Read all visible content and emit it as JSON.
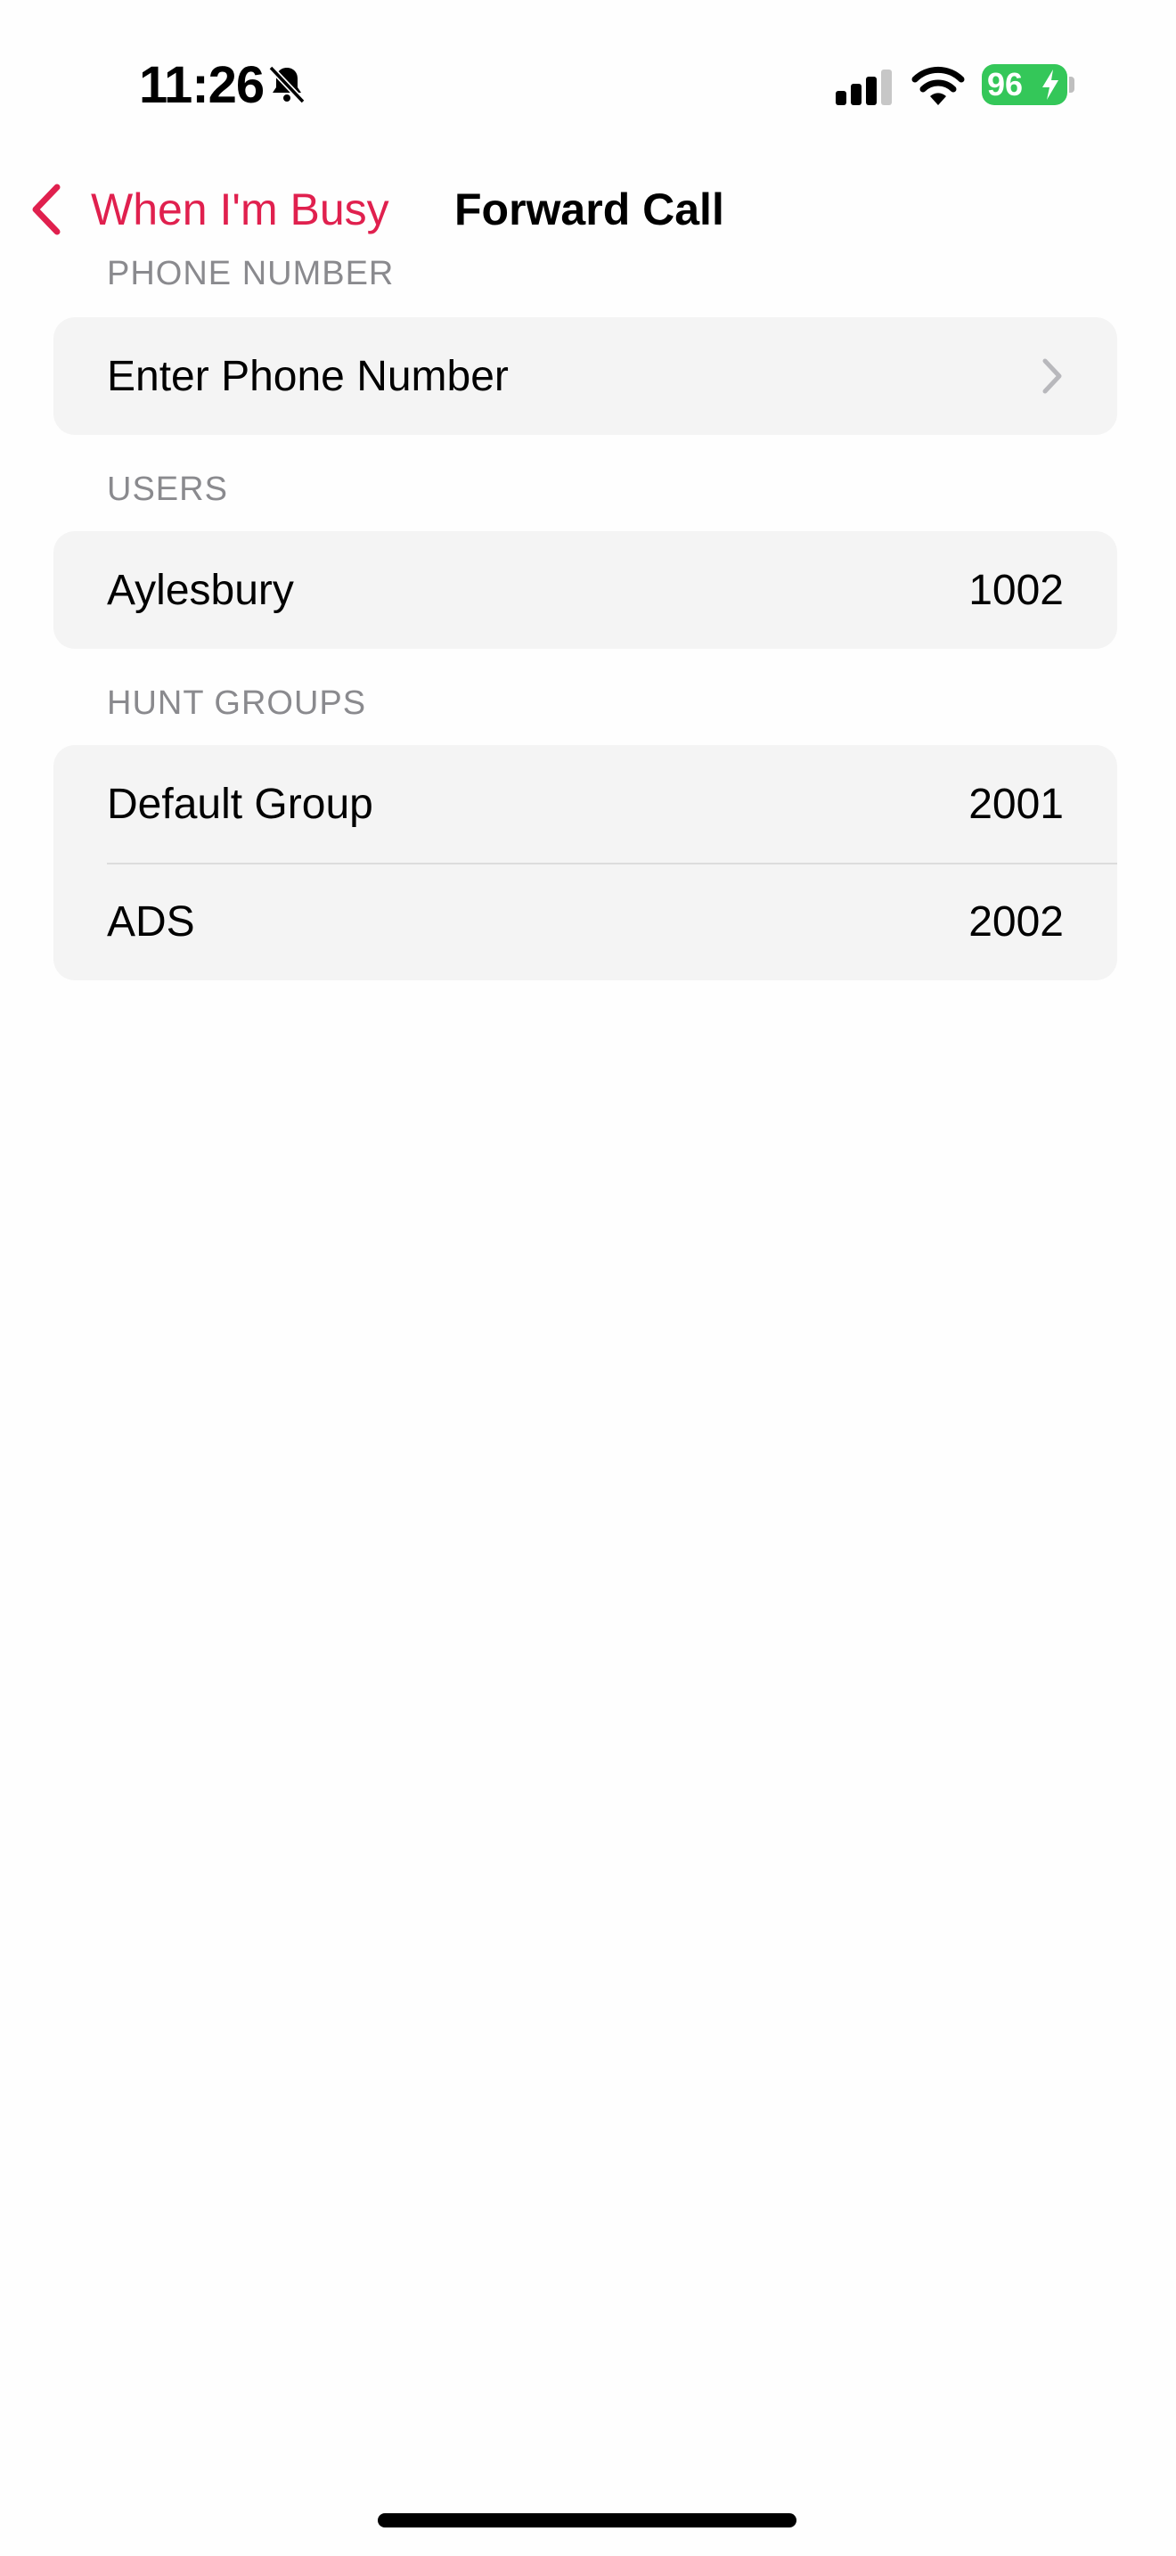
{
  "status_bar": {
    "time": "11:26",
    "battery_level": "96",
    "icons": [
      "bell-slash-icon",
      "cellular-signal-icon",
      "wifi-icon",
      "battery-charging-icon"
    ]
  },
  "nav": {
    "back_label": "When I'm Busy",
    "title": "Forward Call",
    "accent_color": "#e0204e"
  },
  "phone_section": {
    "header": "PHONE NUMBER",
    "row_label": "Enter Phone Number"
  },
  "users_section": {
    "header": "USERS",
    "items": [
      {
        "label": "Aylesbury",
        "value": "1002"
      }
    ]
  },
  "hunt_groups_section": {
    "header": "HUNT GROUPS",
    "items": [
      {
        "label": "Default Group",
        "value": "2001"
      },
      {
        "label": "ADS",
        "value": "2002"
      }
    ]
  }
}
